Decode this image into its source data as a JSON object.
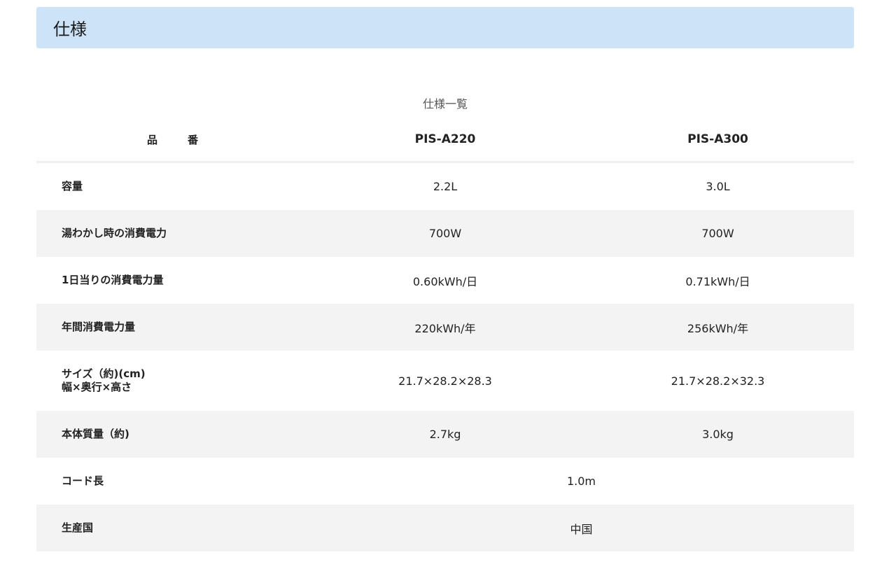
{
  "section": {
    "title": "仕様"
  },
  "spec_table": {
    "caption": "仕様一覧",
    "header": {
      "label": "品　番",
      "models": [
        "PIS-A220",
        "PIS-A300"
      ]
    },
    "rows": [
      {
        "label": "容量",
        "values": [
          "2.2L",
          "3.0L"
        ]
      },
      {
        "label": "湯わかし時の消費電力",
        "values": [
          "700W",
          "700W"
        ]
      },
      {
        "label": "1日当りの消費電力量",
        "values": [
          "0.60kWh/日",
          "0.71kWh/日"
        ]
      },
      {
        "label": "年間消費電力量",
        "values": [
          "220kWh/年",
          "256kWh/年"
        ]
      },
      {
        "label_lines": [
          "サイズ（約)(cm)",
          "幅×奥行×高さ"
        ],
        "values": [
          "21.7×28.2×28.3",
          "21.7×28.2×32.3"
        ]
      },
      {
        "label": "本体質量（約)",
        "values": [
          "2.7kg",
          "3.0kg"
        ]
      },
      {
        "label": "コード長",
        "value": "1.0m"
      },
      {
        "label": "生産国",
        "value": "中国"
      }
    ]
  }
}
